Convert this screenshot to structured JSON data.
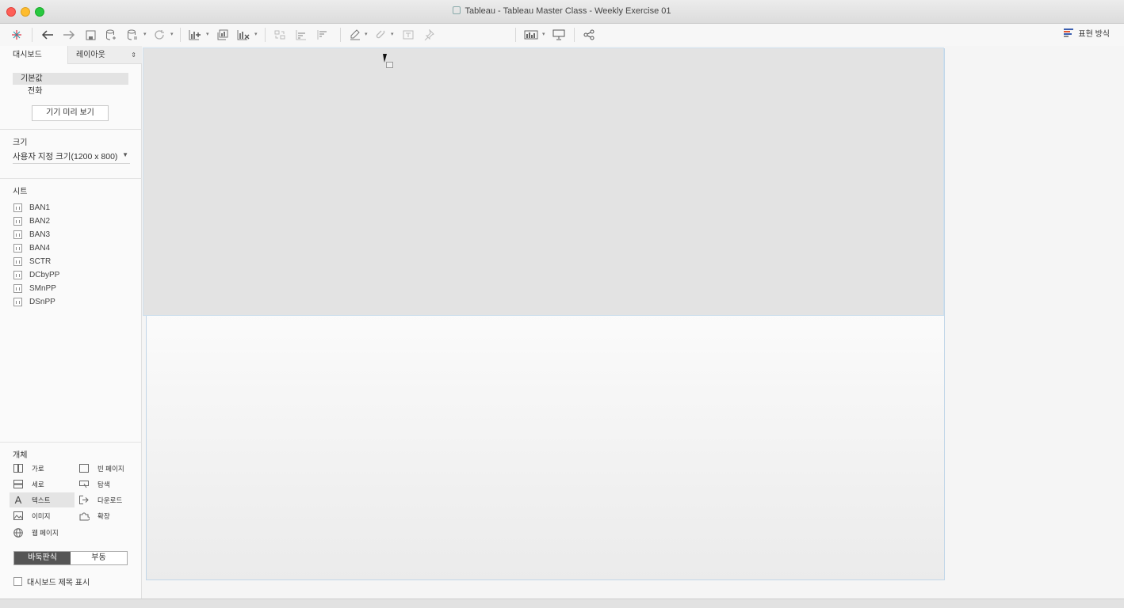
{
  "window": {
    "title": "Tableau - Tableau Master Class - Weekly Exercise 01"
  },
  "toolbar": {
    "presentation_label": "표현 방식"
  },
  "sidebar": {
    "tabs": {
      "dashboard": "대시보드",
      "layout": "레이아웃"
    },
    "devices": {
      "default": "기본값",
      "phone": "전화",
      "preview_button": "기기 미리 보기"
    },
    "size": {
      "title": "크기",
      "value": "사용자 지정 크기(1200 x 800)"
    },
    "sheets": {
      "title": "시트",
      "items": [
        "BAN1",
        "BAN2",
        "BAN3",
        "BAN4",
        "SCTR",
        "DCbyPP",
        "SMnPP",
        "DSnPP"
      ]
    },
    "objects": {
      "title": "개체",
      "horizontal": "가로",
      "blank": "빈 페이지",
      "vertical": "세로",
      "navigation": "탐색",
      "text": "텍스트",
      "download": "다운로드",
      "image": "이미지",
      "extension": "확장",
      "web_page": "웹 페이지"
    },
    "layout_mode": {
      "tiled": "바둑판식",
      "floating": "부동"
    },
    "show_title": "대시보드 제목 표시"
  },
  "colors": {
    "accent_blue": "#c2d6e8",
    "zone_gray": "#e3e3e3",
    "active_segment": "#555555"
  },
  "icons": [
    "tableau-logo-icon",
    "back-icon",
    "forward-icon",
    "save-icon",
    "new-datasource-icon",
    "pause-updates-icon",
    "refresh-icon",
    "new-sheet-icon",
    "duplicate-sheet-icon",
    "clear-sheet-icon",
    "swap-icon",
    "sort-asc-icon",
    "sort-desc-icon",
    "highlight-icon",
    "group-icon",
    "labels-icon",
    "pin-icon",
    "show-me-icon",
    "presentation-icon",
    "share-icon"
  ]
}
